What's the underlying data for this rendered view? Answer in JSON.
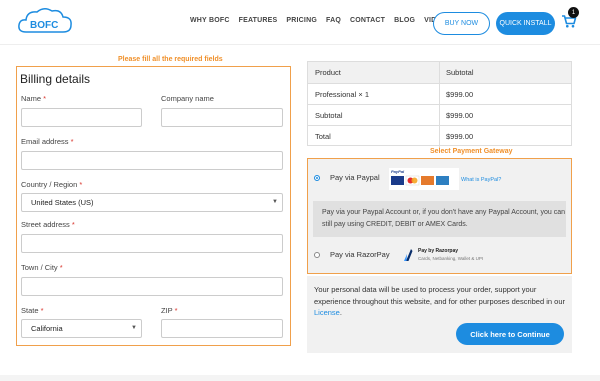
{
  "brand": {
    "logo_text": "BOFC",
    "accent": "#1d8ce0",
    "hint_color": "#f0902a"
  },
  "nav": [
    "WHY BOFC",
    "FEATURES",
    "PRICING",
    "FAQ",
    "CONTACT",
    "BLOG",
    "VIDEOS"
  ],
  "header": {
    "buy_label": "BUY NOW",
    "install_label": "QUICK INSTALL",
    "cart_count": "1"
  },
  "hints": {
    "billing": "Please fill all the required fields",
    "payment": "Select Payment Gateway"
  },
  "billing": {
    "title": "Billing details",
    "name_label": "Name",
    "company_label": "Company name",
    "email_label": "Email address",
    "country_label": "Country / Region",
    "country_value": "United States (US)",
    "street_label": "Street address",
    "town_label": "Town / City",
    "state_label": "State",
    "state_value": "California",
    "zip_label": "ZIP",
    "req": "*"
  },
  "order": {
    "head": [
      "Product",
      "Subtotal"
    ],
    "rows": [
      [
        "Professional  × 1",
        "$999.00"
      ],
      [
        "Subtotal",
        "$999.00"
      ],
      [
        "Total",
        "$999.00"
      ]
    ]
  },
  "payment": {
    "paypal_label": "Pay via Paypal",
    "paypal_link": "What is PayPal?",
    "paypal_logo": "PayPal",
    "paypal_desc": "Pay via your Paypal Account or, if you don't have any Paypal Account, you can still pay using CREDIT, DEBIT or AMEX Cards.",
    "razor_label": "Pay via RazorPay",
    "razor_title": "Pay by Razorpay",
    "razor_sub": "Cards, Netbanking, Wallet & UPI"
  },
  "privacy": {
    "text": "Your personal data will be used to process your order, support your experience throughout this website, and for other purposes described in our ",
    "link": "License",
    "end": "."
  },
  "continue_label": "Click here to Continue"
}
